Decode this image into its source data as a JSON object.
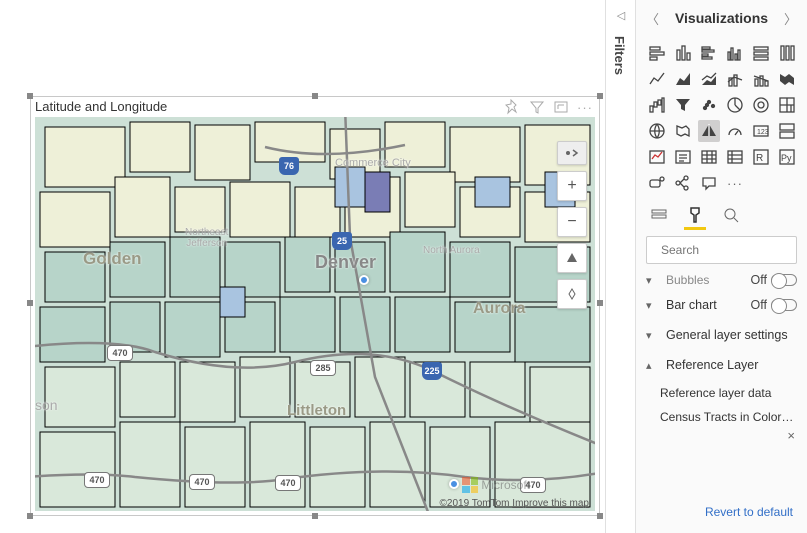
{
  "visual": {
    "title": "Latitude and Longitude",
    "credit_prefix": "©2019 TomTom ",
    "credit_link": "Improve this map",
    "ms_label": "Microsoft"
  },
  "map": {
    "labels": {
      "denver": "Denver",
      "golden": "Golden",
      "aurora": "Aurora",
      "littleton": "Littleton",
      "commerce_city": "Commerce City",
      "north_aurora": "North Aurora",
      "northeast_jefferson": "Northeast\nJefferson",
      "son": "son"
    },
    "shields": {
      "r470": "470",
      "r285": "285",
      "i25": "25",
      "i76": "76",
      "i225": "225"
    }
  },
  "filters": {
    "label": "Filters"
  },
  "viz": {
    "title": "Visualizations",
    "search_placeholder": "Search",
    "sections": {
      "bubbles": "Bubbles",
      "bubbles_state": "Off",
      "bar_chart": "Bar chart",
      "bar_state": "Off",
      "general_layer": "General layer settings",
      "reference_layer": "Reference Layer",
      "ref_data": "Reference layer data",
      "ref_value": "Census Tracts in Colorado..."
    },
    "revert": "Revert to default"
  }
}
